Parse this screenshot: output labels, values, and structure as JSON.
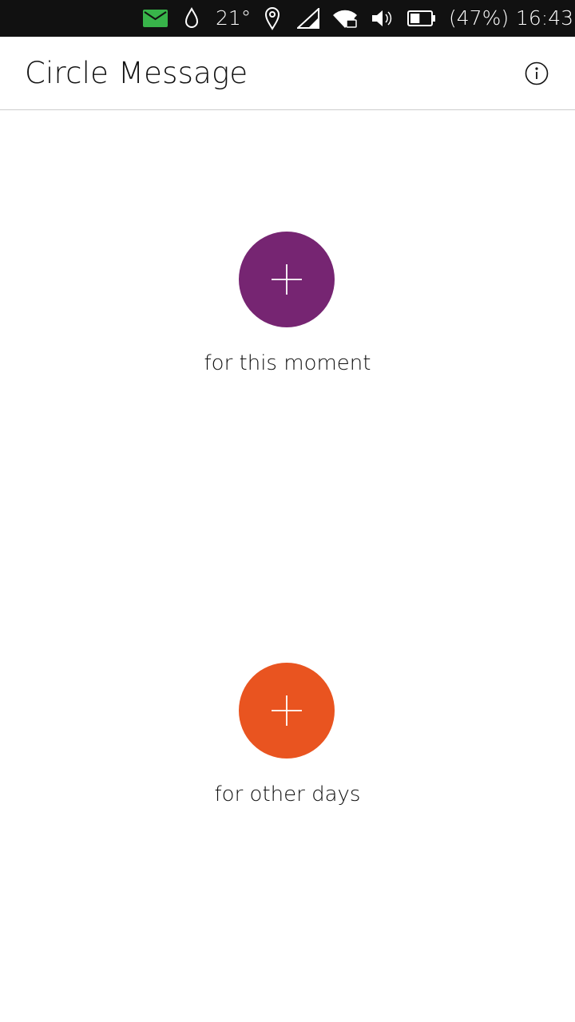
{
  "status_bar": {
    "icons": [
      "mail-icon",
      "water-drop-icon",
      "location-pin-icon",
      "cellular-signal-icon",
      "wifi-lock-icon",
      "volume-icon",
      "battery-icon"
    ],
    "temperature": "21°",
    "battery_level": "(47%)",
    "battery_fraction": 0.47,
    "time": "16:43",
    "mail_color": "#38b44a"
  },
  "header": {
    "title": "Circle Message",
    "info_icon": "info-icon"
  },
  "main": {
    "moment_button": {
      "label": "for this moment",
      "color": "#762572",
      "icon": "plus-icon"
    },
    "other_days_button": {
      "label": "for other days",
      "color": "#e95420",
      "icon": "plus-icon"
    }
  }
}
